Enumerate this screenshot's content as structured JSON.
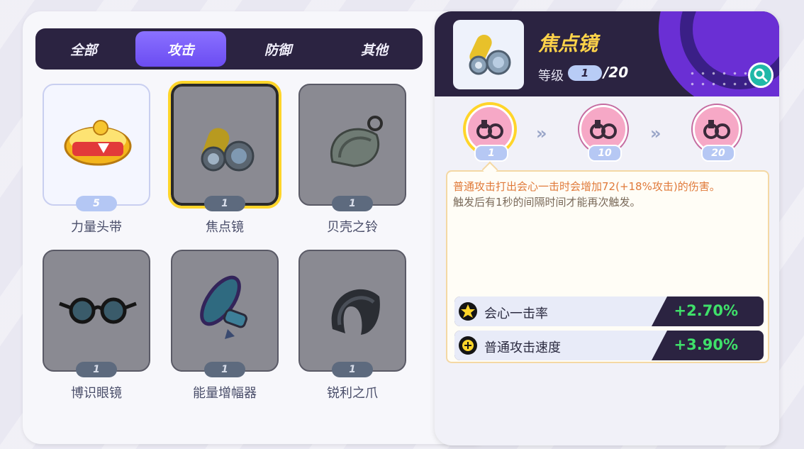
{
  "tabs": [
    {
      "label": "全部",
      "active": false
    },
    {
      "label": "攻击",
      "active": true
    },
    {
      "label": "防御",
      "active": false
    },
    {
      "label": "其他",
      "active": false
    }
  ],
  "items": [
    {
      "name": "力量头带",
      "level": "5",
      "owned": true,
      "selected": false,
      "icon": "headband-icon"
    },
    {
      "name": "焦点镜",
      "level": "1",
      "owned": false,
      "selected": true,
      "icon": "scope-lens-icon"
    },
    {
      "name": "贝壳之铃",
      "level": "1",
      "owned": false,
      "selected": false,
      "icon": "shell-bell-icon"
    },
    {
      "name": "博识眼镜",
      "level": "1",
      "owned": false,
      "selected": false,
      "icon": "wise-glasses-icon"
    },
    {
      "name": "能量增幅器",
      "level": "1",
      "owned": false,
      "selected": false,
      "icon": "energy-amplifier-icon"
    },
    {
      "name": "锐利之爪",
      "level": "1",
      "owned": false,
      "selected": false,
      "icon": "razor-claw-icon"
    }
  ],
  "detail": {
    "title": "焦点镜",
    "level_label": "等级",
    "level": "1",
    "level_max": "/20",
    "stages": [
      "1",
      "10",
      "20"
    ],
    "chevron": "»",
    "description_line1": "普通攻击打出会心一击时会增加72(+18%攻击)的伤害。",
    "description_line2": "触发后有1秒的间隔时间才能再次触发。",
    "stats": [
      {
        "label": "会心一击率",
        "value": "+2.70%",
        "icon": "critical-hit-icon"
      },
      {
        "label": "普通攻击速度",
        "value": "+3.90%",
        "icon": "attack-speed-icon"
      }
    ]
  },
  "colors": {
    "panel_dark": "#2b2341",
    "accent_purple": "#6b4cf2",
    "title_yellow": "#ffd34a",
    "stat_green": "#3fe06a",
    "desc_orange": "#e07a3a"
  }
}
